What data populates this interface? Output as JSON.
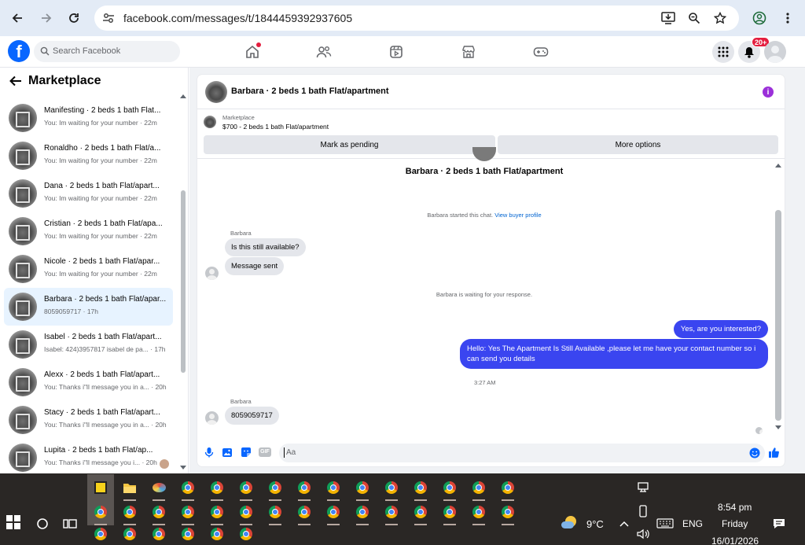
{
  "browser": {
    "url": "facebook.com/messages/t/1844459392937605"
  },
  "fb": {
    "logo": "f",
    "search_placeholder": "Search Facebook",
    "notification_badge": "20+"
  },
  "sidebar": {
    "title": "Marketplace",
    "conversations": [
      {
        "name": "Manifesting · 2 beds 1 bath Flat...",
        "sub": "You: Im waiting for your number · 22m"
      },
      {
        "name": "Ronaldho · 2 beds 1 bath Flat/a...",
        "sub": "You: Im waiting for your number · 22m"
      },
      {
        "name": "Dana · 2 beds 1 bath Flat/apart...",
        "sub": "You: Im waiting for your number · 22m"
      },
      {
        "name": "Cristian · 2 beds 1 bath Flat/apa...",
        "sub": "You: Im waiting for your number · 22m"
      },
      {
        "name": "Nicole · 2 beds 1 bath Flat/apar...",
        "sub": "You: Im waiting for your number · 22m"
      },
      {
        "name": "Barbara · 2 beds 1 bath Flat/apar...",
        "sub": "8059059717 · 17h"
      },
      {
        "name": "Isabel · 2 beds 1 bath Flat/apart...",
        "sub": "Isabel: 424)3957817 isabel de pa... · 17h"
      },
      {
        "name": "Alexx · 2 beds 1 bath Flat/apart...",
        "sub": "You: Thanks i\"ll message you in a... · 20h"
      },
      {
        "name": "Stacy · 2 beds 1 bath Flat/apart...",
        "sub": "You: Thanks i\"ll message you in a... · 20h"
      },
      {
        "name": "Lupita · 2 beds 1 bath Flat/ap...",
        "sub": "You: Thanks i\"ll message you i... · 20h"
      }
    ]
  },
  "chat": {
    "header_title": "Barbara · 2 beds 1 bath Flat/apartment",
    "info_icon": "i",
    "marketplace_label": "Marketplace",
    "listing": "$700 - 2 beds 1 bath Flat/apartment",
    "mark_pending": "Mark as pending",
    "more_options": "More options",
    "center_title": "Barbara · 2 beds 1 bath Flat/apartment",
    "started_text": "Barbara started this chat.",
    "view_profile": "View buyer profile",
    "sender1": "Barbara",
    "msg1": "Is this still available?",
    "msg2": "Message sent",
    "waiting_text": "Barbara is waiting for your response.",
    "out1": "Yes, are you interested?",
    "out2": "Hello: Yes The Apartment Is Still Available ,please let me have your contact number so i can send you details",
    "time": "3:27 AM",
    "sender2": "Barbara",
    "msg3": "8059059717",
    "composer_placeholder": "Aa",
    "gif_label": "GIF"
  },
  "taskbar": {
    "temperature": "9°C",
    "language": "ENG",
    "time": "8:54 pm",
    "day": "Friday",
    "date": "16/01/2026"
  },
  "colors": {
    "fb_blue": "#0866ff",
    "outgoing_bubble": "#3a45f0",
    "badge_red": "#e41e3f",
    "info_purple": "#9b30d9",
    "active_conv": "#e7f3ff"
  }
}
